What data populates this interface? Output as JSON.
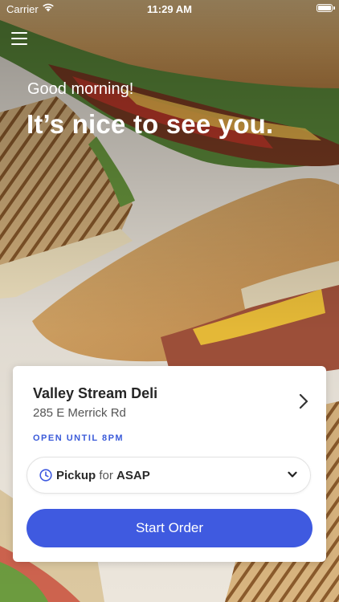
{
  "status_bar": {
    "carrier": "Carrier",
    "time": "11:29 AM"
  },
  "icons": {
    "menu": "hamburger-menu-icon",
    "wifi": "wifi-icon",
    "battery": "battery-icon",
    "chevron": "chevron-right-icon",
    "clock": "clock-icon",
    "dropdown": "chevron-down-icon"
  },
  "greeting": {
    "subtitle": "Good morning!",
    "title": "It’s nice to see you."
  },
  "store": {
    "name": "Valley Stream Deli",
    "address": "285 E Merrick Rd",
    "hours": "OPEN UNTIL 8PM"
  },
  "order": {
    "mode": "Pickup",
    "connector": "for",
    "time": "ASAP",
    "start_label": "Start Order"
  },
  "colors": {
    "accent": "#3f5ae0",
    "hours_text": "#3b5bd9",
    "card_bg": "#ffffff"
  }
}
